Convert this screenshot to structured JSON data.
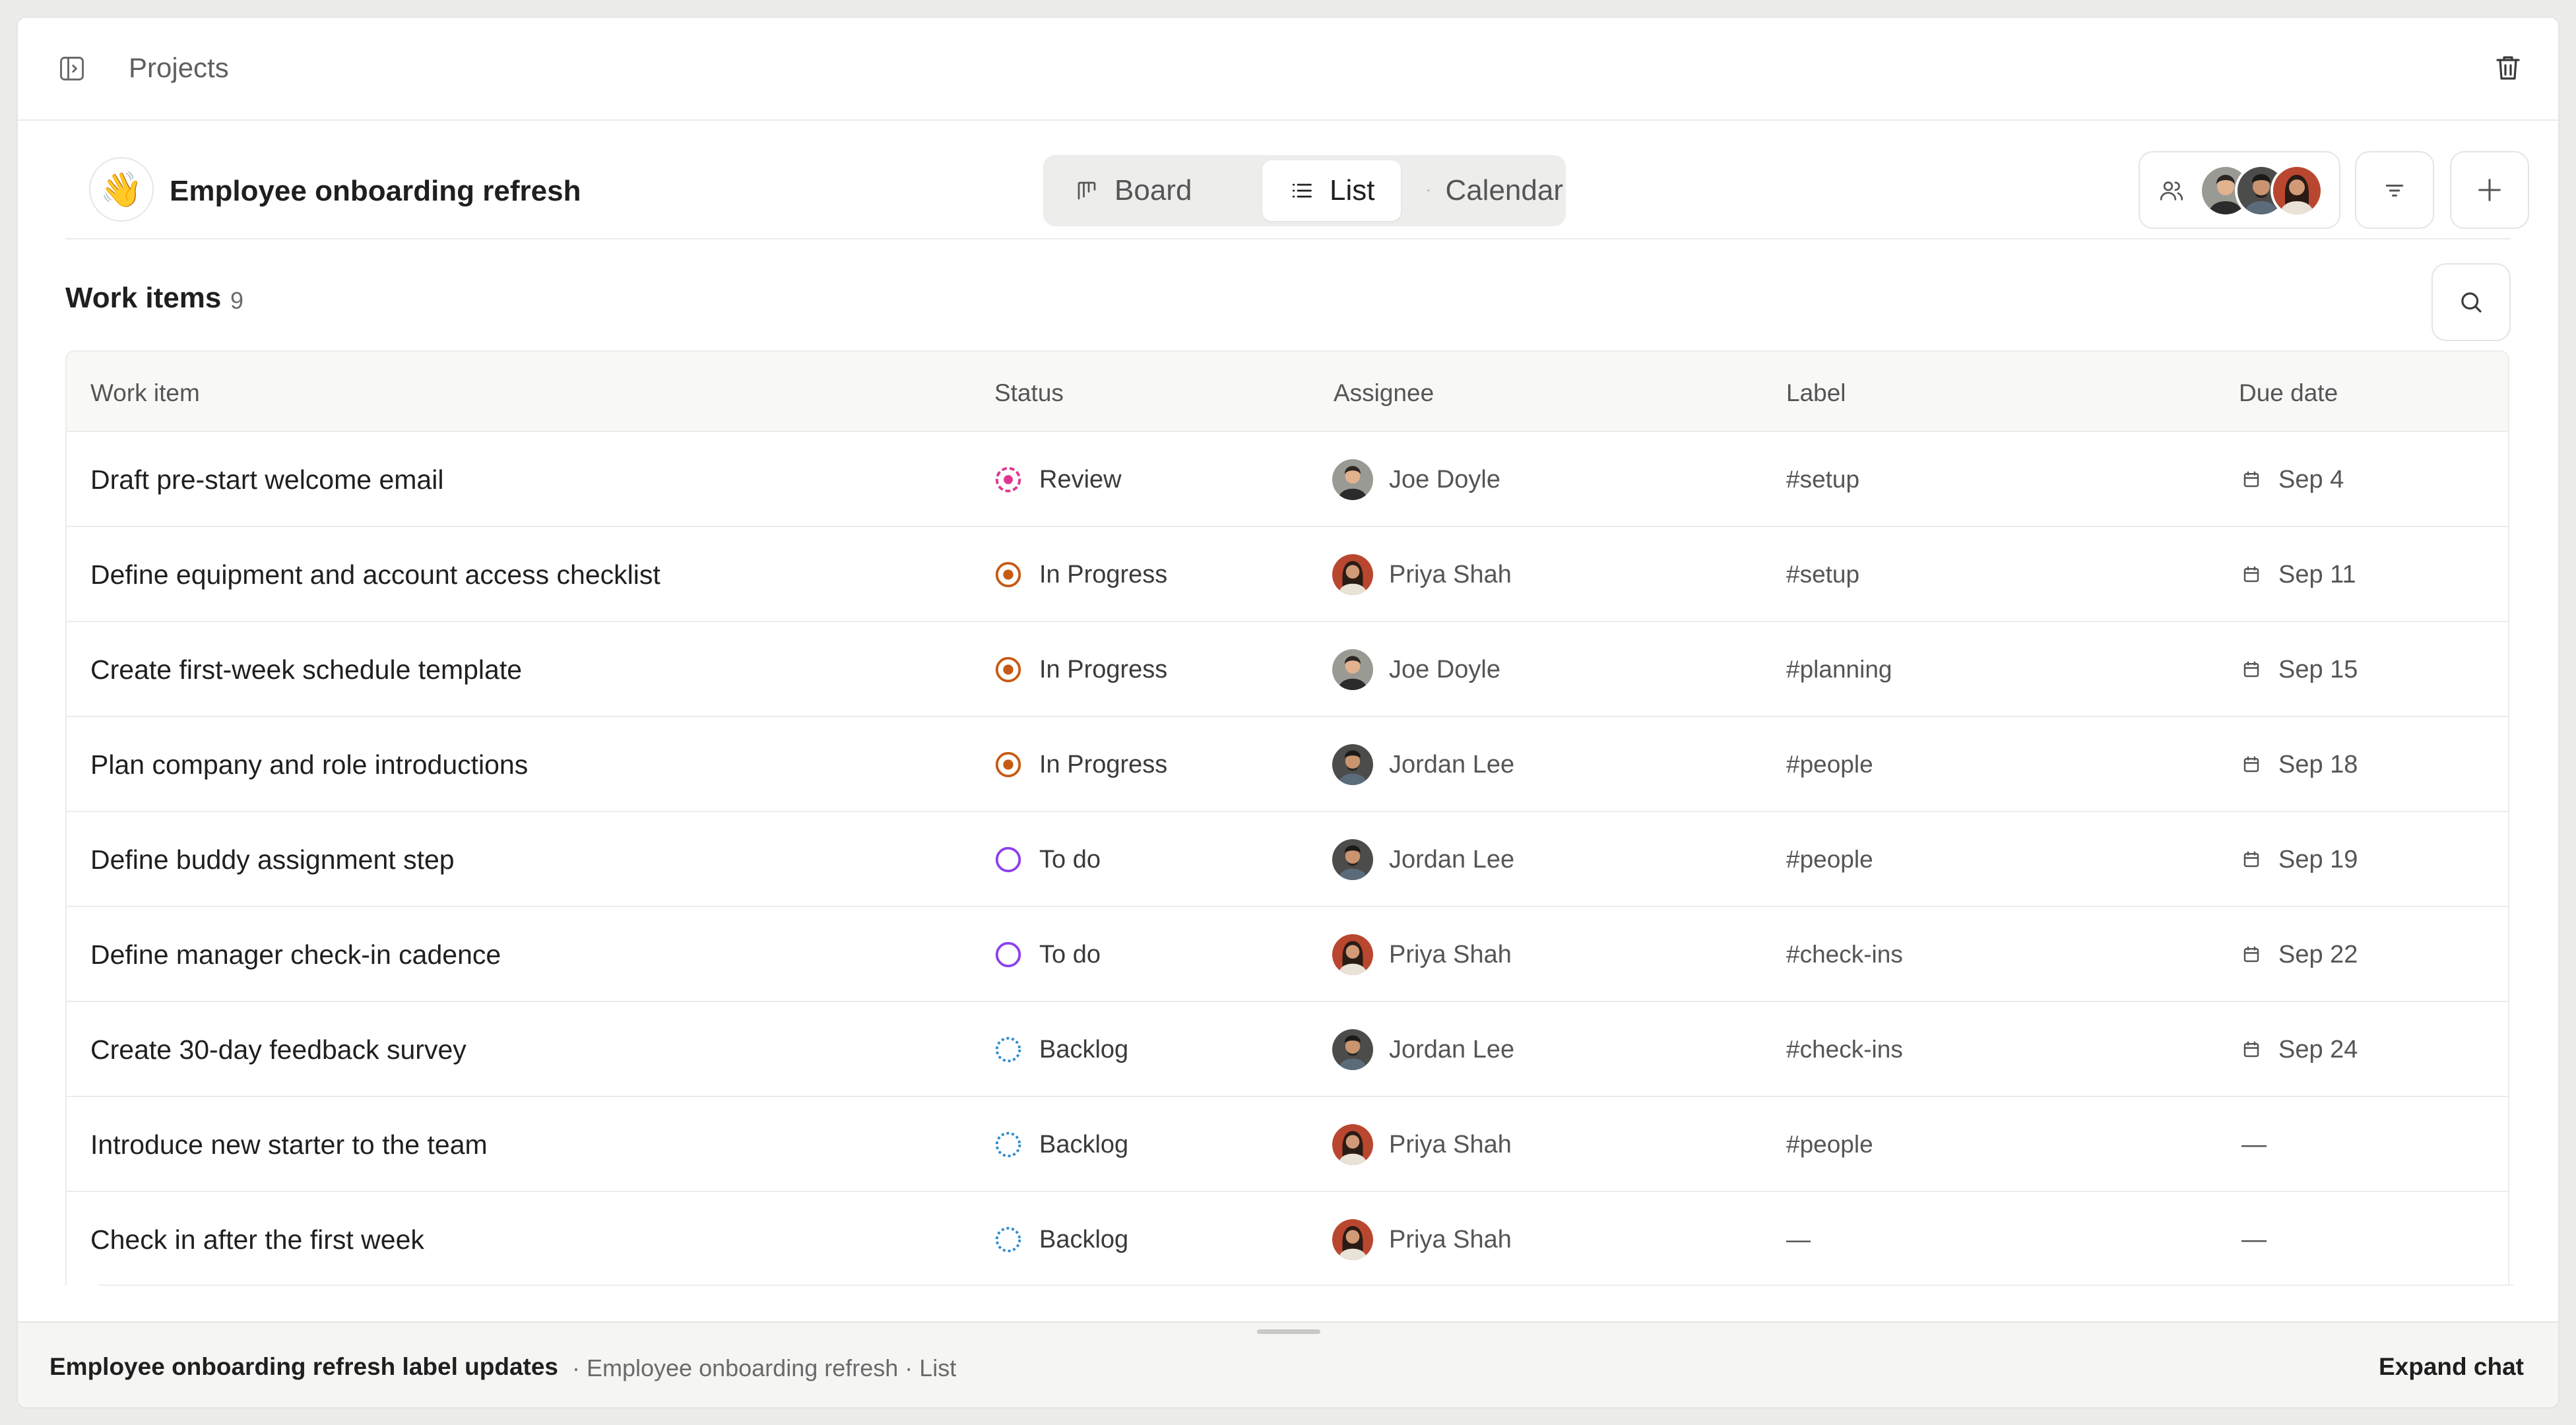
{
  "topbar": {
    "title": "Projects"
  },
  "project": {
    "emoji": "👋",
    "name": "Employee onboarding refresh"
  },
  "views": [
    {
      "label": "Board",
      "icon": "board-icon",
      "active": false
    },
    {
      "label": "List",
      "icon": "list-icon",
      "active": true
    },
    {
      "label": "Calendar",
      "icon": "calendar-icon",
      "active": false
    }
  ],
  "section": {
    "title": "Work items",
    "count": "9"
  },
  "columns": [
    "Work item",
    "Status",
    "Assignee",
    "Label",
    "Due date"
  ],
  "status_colors": {
    "Review": "#e0358f",
    "In Progress": "#c65a14",
    "To do": "#8b3ff0",
    "Backlog": "#2a8ad0"
  },
  "rows": [
    {
      "item": "Draft pre-start welcome email",
      "status": "Review",
      "assignee": "Joe Doyle",
      "label": "#setup",
      "due": "Sep 4"
    },
    {
      "item": "Define equipment and account access checklist",
      "status": "In Progress",
      "assignee": "Priya Shah",
      "label": "#setup",
      "due": "Sep 11"
    },
    {
      "item": "Create first-week schedule template",
      "status": "In Progress",
      "assignee": "Joe Doyle",
      "label": "#planning",
      "due": "Sep 15"
    },
    {
      "item": "Plan company and role introductions",
      "status": "In Progress",
      "assignee": "Jordan Lee",
      "label": "#people",
      "due": "Sep 18"
    },
    {
      "item": "Define buddy assignment step",
      "status": "To do",
      "assignee": "Jordan Lee",
      "label": "#people",
      "due": "Sep 19"
    },
    {
      "item": "Define manager check-in cadence",
      "status": "To do",
      "assignee": "Priya Shah",
      "label": "#check-ins",
      "due": "Sep 22"
    },
    {
      "item": "Create 30-day feedback survey",
      "status": "Backlog",
      "assignee": "Jordan Lee",
      "label": "#check-ins",
      "due": "Sep 24"
    },
    {
      "item": "Introduce new starter to the team",
      "status": "Backlog",
      "assignee": "Priya Shah",
      "label": "#people",
      "due": "—"
    },
    {
      "item": "Check in after the first week",
      "status": "Backlog",
      "assignee": "Priya Shah",
      "label": "—",
      "due": "—"
    }
  ],
  "footer": {
    "chat_title": "Employee onboarding refresh label updates",
    "chat_path": "· Employee onboarding refresh · List",
    "expand_label": "Expand chat"
  }
}
